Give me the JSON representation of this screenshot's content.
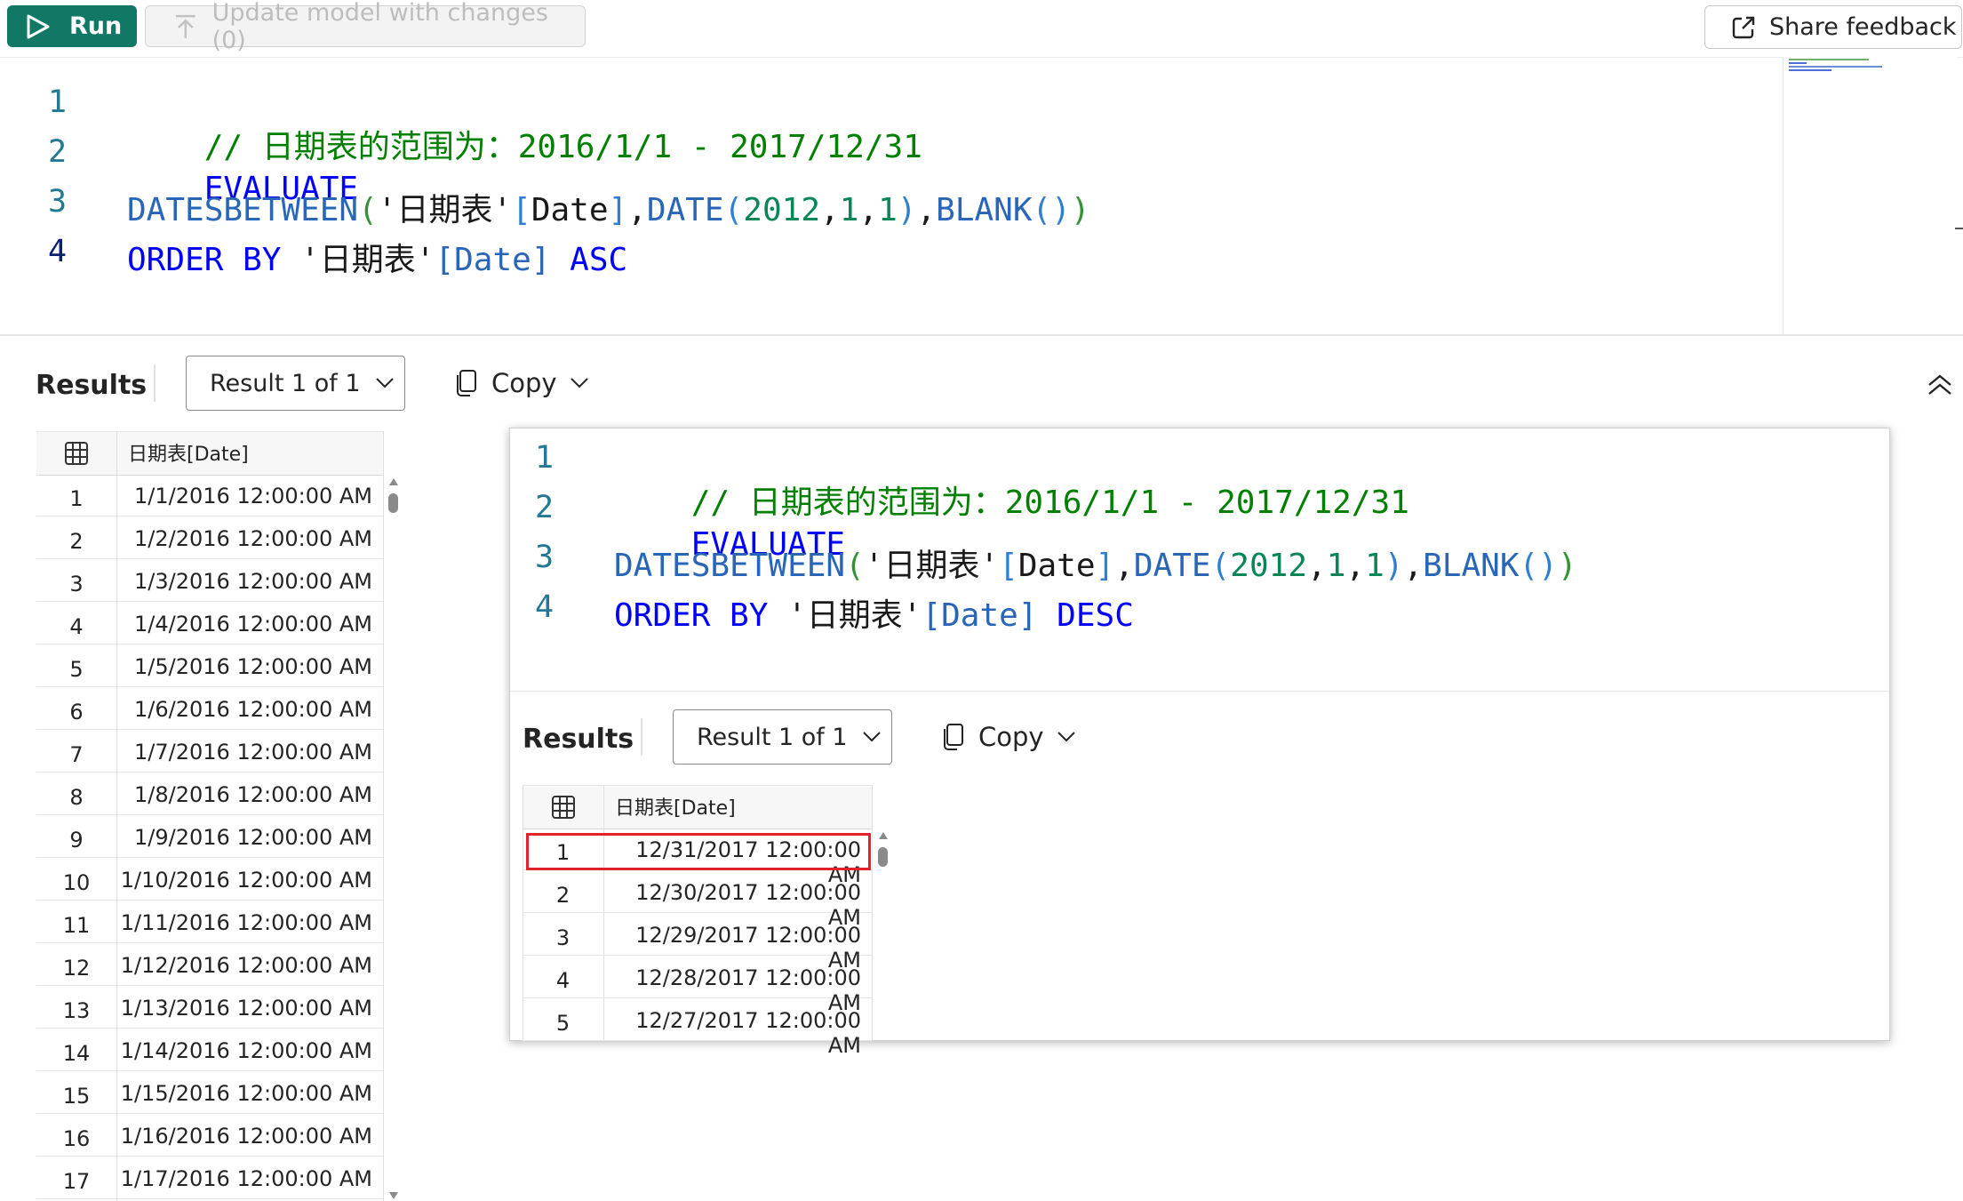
{
  "toolbar": {
    "run_label": "Run",
    "update_label": "Update model with changes (0)",
    "share_label": "Share feedback"
  },
  "editor": {
    "line_numbers": [
      "1",
      "2",
      "3",
      "4"
    ],
    "line1_comment": "// 日期表的范围为：2016/1/1 - 2017/12/31",
    "line2": "EVALUATE",
    "line3_fn": "DATESBETWEEN",
    "line3_table": "'日期表'",
    "line3_col": "[Date]",
    "line3_date_fn": "DATE",
    "line3_args": [
      "2012",
      "1",
      "1"
    ],
    "line3_blank": "BLANK",
    "line4_kw": "ORDER BY",
    "line4_table": "'日期表'",
    "line4_col": "[Date]",
    "line4_order": "ASC"
  },
  "results": {
    "title": "Results",
    "result_selector": "Result 1 of 1",
    "copy_label": "Copy",
    "column_header": "日期表[Date]",
    "rows": [
      {
        "n": "1",
        "v": "1/1/2016 12:00:00 AM"
      },
      {
        "n": "2",
        "v": "1/2/2016 12:00:00 AM"
      },
      {
        "n": "3",
        "v": "1/3/2016 12:00:00 AM"
      },
      {
        "n": "4",
        "v": "1/4/2016 12:00:00 AM"
      },
      {
        "n": "5",
        "v": "1/5/2016 12:00:00 AM"
      },
      {
        "n": "6",
        "v": "1/6/2016 12:00:00 AM"
      },
      {
        "n": "7",
        "v": "1/7/2016 12:00:00 AM"
      },
      {
        "n": "8",
        "v": "1/8/2016 12:00:00 AM"
      },
      {
        "n": "9",
        "v": "1/9/2016 12:00:00 AM"
      },
      {
        "n": "10",
        "v": "1/10/2016 12:00:00 AM"
      },
      {
        "n": "11",
        "v": "1/11/2016 12:00:00 AM"
      },
      {
        "n": "12",
        "v": "1/12/2016 12:00:00 AM"
      },
      {
        "n": "13",
        "v": "1/13/2016 12:00:00 AM"
      },
      {
        "n": "14",
        "v": "1/14/2016 12:00:00 AM"
      },
      {
        "n": "15",
        "v": "1/15/2016 12:00:00 AM"
      },
      {
        "n": "16",
        "v": "1/16/2016 12:00:00 AM"
      },
      {
        "n": "17",
        "v": "1/17/2016 12:00:00 AM"
      }
    ]
  },
  "popup": {
    "line_numbers": [
      "1",
      "2",
      "3",
      "4"
    ],
    "line1_comment": "// 日期表的范围为：2016/1/1 - 2017/12/31",
    "line2": "EVALUATE",
    "line3_fn": "DATESBETWEEN",
    "line3_table": "'日期表'",
    "line3_col": "[Date]",
    "line3_date_fn": "DATE",
    "line3_args": [
      "2012",
      "1",
      "1"
    ],
    "line3_blank": "BLANK",
    "line4_kw": "ORDER BY",
    "line4_table": "'日期表'",
    "line4_col": "[Date]",
    "line4_order": "DESC",
    "results_title": "Results",
    "result_selector": "Result 1 of 1",
    "copy_label": "Copy",
    "column_header": "日期表[Date]",
    "rows": [
      {
        "n": "1",
        "v": "12/31/2017 12:00:00 AM"
      },
      {
        "n": "2",
        "v": "12/30/2017 12:00:00 AM"
      },
      {
        "n": "3",
        "v": "12/29/2017 12:00:00 AM"
      },
      {
        "n": "4",
        "v": "12/28/2017 12:00:00 AM"
      },
      {
        "n": "5",
        "v": "12/27/2017 12:00:00 AM"
      }
    ]
  },
  "colors": {
    "run_button": "#117865",
    "highlight_border": "#e1222a",
    "comment": "#008000",
    "keyword": "#0000ff"
  }
}
